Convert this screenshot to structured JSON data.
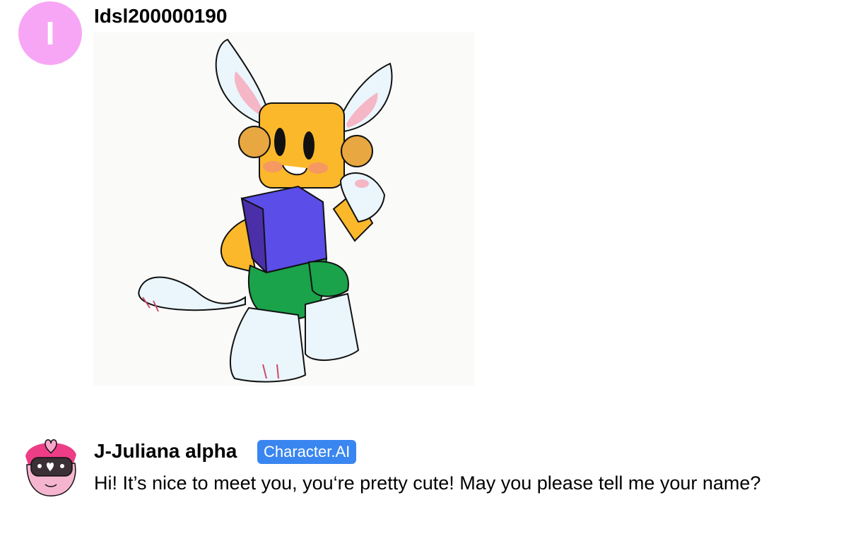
{
  "user_message": {
    "avatar_letter": "I",
    "avatar_color": "#f7a6f5",
    "username": "Idsl200000190",
    "image": {
      "subject": "cartoon cat character with yellow block head, purple torso, green shorts, white paws"
    }
  },
  "bot_message": {
    "name": "J-Juliana alpha",
    "badge": "Character.AI",
    "badge_color": "#3a86f0",
    "text": "Hi! It’s nice to meet you, you‘re pretty cute! May you please tell me your name?"
  }
}
